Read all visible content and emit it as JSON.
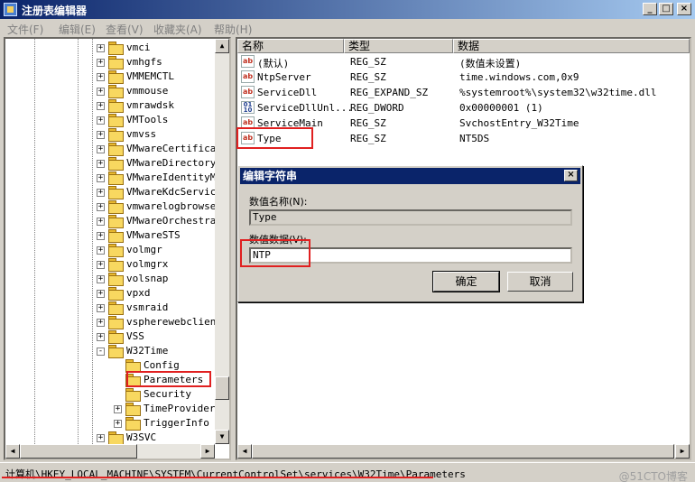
{
  "window": {
    "title": "注册表编辑器",
    "min": "_",
    "max": "□",
    "close": "×"
  },
  "menu": [
    "文件(F)",
    "编辑(E)",
    "查看(V)",
    "收藏夹(A)",
    "帮助(H)"
  ],
  "tree": [
    {
      "label": "vmci",
      "expand": "+"
    },
    {
      "label": "vmhgfs",
      "expand": "+"
    },
    {
      "label": "VMMEMCTL",
      "expand": "+"
    },
    {
      "label": "vmmouse",
      "expand": "+"
    },
    {
      "label": "vmrawdsk",
      "expand": "+"
    },
    {
      "label": "VMTools",
      "expand": "+"
    },
    {
      "label": "vmvss",
      "expand": "+"
    },
    {
      "label": "VMwareCertificat",
      "expand": "+"
    },
    {
      "label": "VMwareDirectoryS",
      "expand": "+"
    },
    {
      "label": "VMwareIdentityMg",
      "expand": "+"
    },
    {
      "label": "VMwareKdcService",
      "expand": "+"
    },
    {
      "label": "vmwarelogbrowser",
      "expand": "+"
    },
    {
      "label": "VMwareOrchestrat",
      "expand": "+"
    },
    {
      "label": "VMwareSTS",
      "expand": "+"
    },
    {
      "label": "volmgr",
      "expand": "+"
    },
    {
      "label": "volmgrx",
      "expand": "+"
    },
    {
      "label": "volsnap",
      "expand": "+"
    },
    {
      "label": "vpxd",
      "expand": "+"
    },
    {
      "label": "vsmraid",
      "expand": "+"
    },
    {
      "label": "vspherewebclient",
      "expand": "+"
    },
    {
      "label": "VSS",
      "expand": "+"
    },
    {
      "label": "W32Time",
      "expand": "-"
    },
    {
      "label": "Config",
      "expand": "",
      "indent": 1
    },
    {
      "label": "Parameters",
      "expand": "",
      "indent": 1,
      "selected": true
    },
    {
      "label": "Security",
      "expand": "",
      "indent": 1
    },
    {
      "label": "TimeProviders",
      "expand": "+",
      "indent": 1
    },
    {
      "label": "TriggerInfo",
      "expand": "+",
      "indent": 1
    },
    {
      "label": "W3SVC",
      "expand": "+"
    }
  ],
  "list": {
    "columns": [
      "名称",
      "类型",
      "数据"
    ],
    "rows": [
      {
        "icon": "ab",
        "name": "(默认)",
        "type": "REG_SZ",
        "data": "(数值未设置)"
      },
      {
        "icon": "ab",
        "name": "NtpServer",
        "type": "REG_SZ",
        "data": "time.windows.com,0x9"
      },
      {
        "icon": "ab",
        "name": "ServiceDll",
        "type": "REG_EXPAND_SZ",
        "data": "%systemroot%\\system32\\w32time.dll"
      },
      {
        "icon": "bin",
        "name": "ServiceDllUnl...",
        "type": "REG_DWORD",
        "data": "0x00000001 (1)"
      },
      {
        "icon": "ab",
        "name": "ServiceMain",
        "type": "REG_SZ",
        "data": "SvchostEntry_W32Time"
      },
      {
        "icon": "ab",
        "name": "Type",
        "type": "REG_SZ",
        "data": "NT5DS"
      }
    ]
  },
  "dialog": {
    "title": "编辑字符串",
    "close": "×",
    "name_label": "数值名称(N):",
    "name_value": "Type",
    "data_label": "数值数据(V):",
    "data_value": "NTP",
    "ok": "确定",
    "cancel": "取消"
  },
  "status": {
    "path": "计算机\\HKEY_LOCAL_MACHINE\\SYSTEM\\CurrentControlSet\\services\\W32Time\\Parameters",
    "watermark": "@51CTO博客"
  }
}
